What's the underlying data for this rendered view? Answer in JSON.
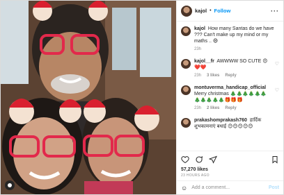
{
  "header": {
    "username": "kajol",
    "separator": "•",
    "follow_label": "Follow",
    "more_label": "···"
  },
  "comments": [
    {
      "username": "kajol",
      "text": "How many Santas do we have ??? Can't make up my mind or my maths .. 😄",
      "time": "23h"
    },
    {
      "username": "kajol__fr",
      "text": "AWWWW SO CUTE 😍❤️❤️",
      "time": "23h",
      "likes": "3 likes",
      "reply": "Reply"
    },
    {
      "username": "montuverma_handicap_official",
      "text": "Merry christmas 🎄🎄🎄🎄🎄🎄🎄🎄🎄🎄🎄🎁🎁🎁",
      "time": "23h",
      "likes": "2 likes",
      "reply": "Reply"
    },
    {
      "username": "prakashomprakash760",
      "text": "हार्दिक शुभकामनाएं बधाई 😊😊😊😊😊",
      "time": "",
      "likes": "",
      "reply": ""
    }
  ],
  "actions": {
    "likes_count": "57,270 likes",
    "time_ago": "23 HOURS AGO"
  },
  "add_comment": {
    "placeholder": "Add a comment...",
    "post_label": "Post"
  }
}
